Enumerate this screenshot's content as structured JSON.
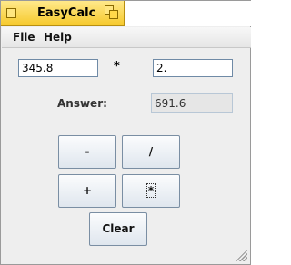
{
  "window": {
    "title": "EasyCalc"
  },
  "menu": {
    "file": "File",
    "help": "Help"
  },
  "calc": {
    "operand_a": "345.8",
    "operator": "*",
    "operand_b": "2.",
    "answer_label": "Answer:",
    "answer_value": "691.6"
  },
  "buttons": {
    "minus": "-",
    "divide": "/",
    "plus": "+",
    "multiply": "*",
    "clear": "Clear"
  }
}
